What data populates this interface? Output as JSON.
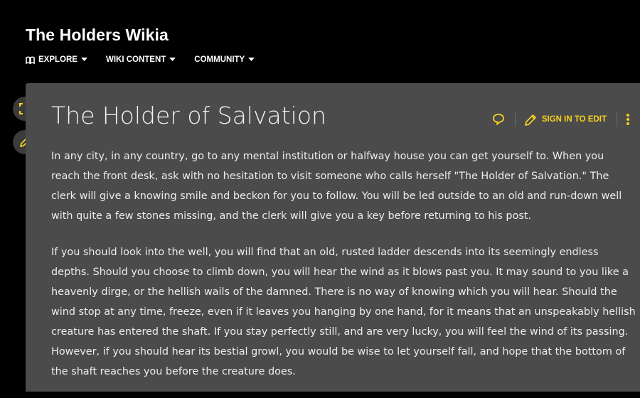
{
  "site": {
    "title": "The Holders Wikia"
  },
  "nav": {
    "items": [
      {
        "label": "EXPLORE",
        "icon": "book-icon"
      },
      {
        "label": "WIKI CONTENT"
      },
      {
        "label": "COMMUNITY"
      }
    ]
  },
  "rail": {
    "fullscreen_icon": "fullscreen-icon",
    "edit_icon": "pencil-icon"
  },
  "page": {
    "title": "The Holder of Salvation",
    "actions": {
      "comments_icon": "speech-bubble-icon",
      "edit_label": "SIGN IN TO EDIT",
      "more_icon": "kebab-menu-icon"
    },
    "paragraphs": [
      "In any city, in any country, go to any mental institution or halfway house you can get yourself to. When you reach the front desk, ask with no hesitation to visit someone who calls herself \"The Holder of Salvation.\" The clerk will give a knowing smile and beckon for you to follow. You will be led outside to an old and run-down well with quite a few stones missing, and the clerk will give you a key before returning to his post.",
      "If you should look into the well, you will find that an old, rusted ladder descends into its seemingly endless depths. Should you choose to climb down, you will hear the wind as it blows past you. It may sound to you like a heavenly dirge, or the hellish wails of the damned. There is no way of knowing which you will hear. Should the wind stop at any time, freeze, even if it leaves you hanging by one hand, for it means that an unspeakably hellish creature has entered the shaft. If you stay perfectly still, and are very lucky, you will feel the wind of its passing. However, if you should hear its bestial growl, you would be wise to let yourself fall, and hope that the bottom of the shaft reaches you before the creature does."
    ]
  },
  "colors": {
    "accent": "#f7d11e",
    "background": "#000000",
    "content_bg": "#4b4b4b"
  }
}
